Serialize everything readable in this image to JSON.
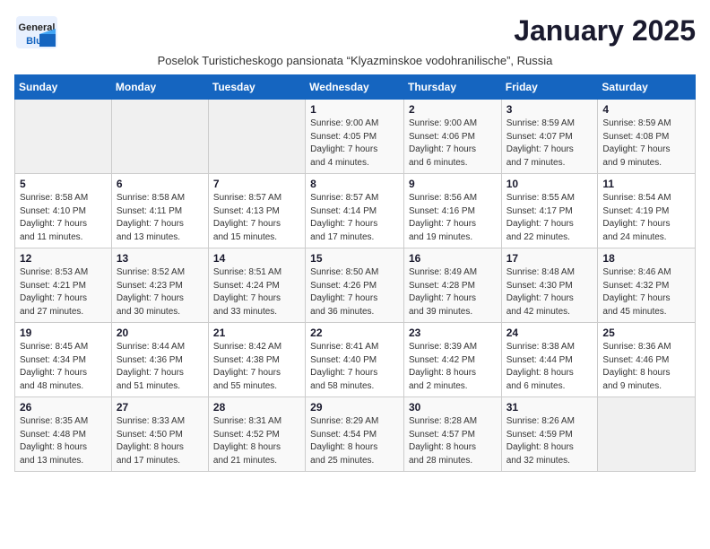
{
  "header": {
    "logo_general": "General",
    "logo_blue": "Blue",
    "month_title": "January 2025",
    "subtitle": "Poselok Turisticheskogo pansionata “Klyazminskoe vodohranilische”, Russia"
  },
  "days_of_week": [
    "Sunday",
    "Monday",
    "Tuesday",
    "Wednesday",
    "Thursday",
    "Friday",
    "Saturday"
  ],
  "weeks": [
    [
      {
        "day": "",
        "info": ""
      },
      {
        "day": "",
        "info": ""
      },
      {
        "day": "",
        "info": ""
      },
      {
        "day": "1",
        "info": "Sunrise: 9:00 AM\nSunset: 4:05 PM\nDaylight: 7 hours\nand 4 minutes."
      },
      {
        "day": "2",
        "info": "Sunrise: 9:00 AM\nSunset: 4:06 PM\nDaylight: 7 hours\nand 6 minutes."
      },
      {
        "day": "3",
        "info": "Sunrise: 8:59 AM\nSunset: 4:07 PM\nDaylight: 7 hours\nand 7 minutes."
      },
      {
        "day": "4",
        "info": "Sunrise: 8:59 AM\nSunset: 4:08 PM\nDaylight: 7 hours\nand 9 minutes."
      }
    ],
    [
      {
        "day": "5",
        "info": "Sunrise: 8:58 AM\nSunset: 4:10 PM\nDaylight: 7 hours\nand 11 minutes."
      },
      {
        "day": "6",
        "info": "Sunrise: 8:58 AM\nSunset: 4:11 PM\nDaylight: 7 hours\nand 13 minutes."
      },
      {
        "day": "7",
        "info": "Sunrise: 8:57 AM\nSunset: 4:13 PM\nDaylight: 7 hours\nand 15 minutes."
      },
      {
        "day": "8",
        "info": "Sunrise: 8:57 AM\nSunset: 4:14 PM\nDaylight: 7 hours\nand 17 minutes."
      },
      {
        "day": "9",
        "info": "Sunrise: 8:56 AM\nSunset: 4:16 PM\nDaylight: 7 hours\nand 19 minutes."
      },
      {
        "day": "10",
        "info": "Sunrise: 8:55 AM\nSunset: 4:17 PM\nDaylight: 7 hours\nand 22 minutes."
      },
      {
        "day": "11",
        "info": "Sunrise: 8:54 AM\nSunset: 4:19 PM\nDaylight: 7 hours\nand 24 minutes."
      }
    ],
    [
      {
        "day": "12",
        "info": "Sunrise: 8:53 AM\nSunset: 4:21 PM\nDaylight: 7 hours\nand 27 minutes."
      },
      {
        "day": "13",
        "info": "Sunrise: 8:52 AM\nSunset: 4:23 PM\nDaylight: 7 hours\nand 30 minutes."
      },
      {
        "day": "14",
        "info": "Sunrise: 8:51 AM\nSunset: 4:24 PM\nDaylight: 7 hours\nand 33 minutes."
      },
      {
        "day": "15",
        "info": "Sunrise: 8:50 AM\nSunset: 4:26 PM\nDaylight: 7 hours\nand 36 minutes."
      },
      {
        "day": "16",
        "info": "Sunrise: 8:49 AM\nSunset: 4:28 PM\nDaylight: 7 hours\nand 39 minutes."
      },
      {
        "day": "17",
        "info": "Sunrise: 8:48 AM\nSunset: 4:30 PM\nDaylight: 7 hours\nand 42 minutes."
      },
      {
        "day": "18",
        "info": "Sunrise: 8:46 AM\nSunset: 4:32 PM\nDaylight: 7 hours\nand 45 minutes."
      }
    ],
    [
      {
        "day": "19",
        "info": "Sunrise: 8:45 AM\nSunset: 4:34 PM\nDaylight: 7 hours\nand 48 minutes."
      },
      {
        "day": "20",
        "info": "Sunrise: 8:44 AM\nSunset: 4:36 PM\nDaylight: 7 hours\nand 51 minutes."
      },
      {
        "day": "21",
        "info": "Sunrise: 8:42 AM\nSunset: 4:38 PM\nDaylight: 7 hours\nand 55 minutes."
      },
      {
        "day": "22",
        "info": "Sunrise: 8:41 AM\nSunset: 4:40 PM\nDaylight: 7 hours\nand 58 minutes."
      },
      {
        "day": "23",
        "info": "Sunrise: 8:39 AM\nSunset: 4:42 PM\nDaylight: 8 hours\nand 2 minutes."
      },
      {
        "day": "24",
        "info": "Sunrise: 8:38 AM\nSunset: 4:44 PM\nDaylight: 8 hours\nand 6 minutes."
      },
      {
        "day": "25",
        "info": "Sunrise: 8:36 AM\nSunset: 4:46 PM\nDaylight: 8 hours\nand 9 minutes."
      }
    ],
    [
      {
        "day": "26",
        "info": "Sunrise: 8:35 AM\nSunset: 4:48 PM\nDaylight: 8 hours\nand 13 minutes."
      },
      {
        "day": "27",
        "info": "Sunrise: 8:33 AM\nSunset: 4:50 PM\nDaylight: 8 hours\nand 17 minutes."
      },
      {
        "day": "28",
        "info": "Sunrise: 8:31 AM\nSunset: 4:52 PM\nDaylight: 8 hours\nand 21 minutes."
      },
      {
        "day": "29",
        "info": "Sunrise: 8:29 AM\nSunset: 4:54 PM\nDaylight: 8 hours\nand 25 minutes."
      },
      {
        "day": "30",
        "info": "Sunrise: 8:28 AM\nSunset: 4:57 PM\nDaylight: 8 hours\nand 28 minutes."
      },
      {
        "day": "31",
        "info": "Sunrise: 8:26 AM\nSunset: 4:59 PM\nDaylight: 8 hours\nand 32 minutes."
      },
      {
        "day": "",
        "info": ""
      }
    ]
  ]
}
